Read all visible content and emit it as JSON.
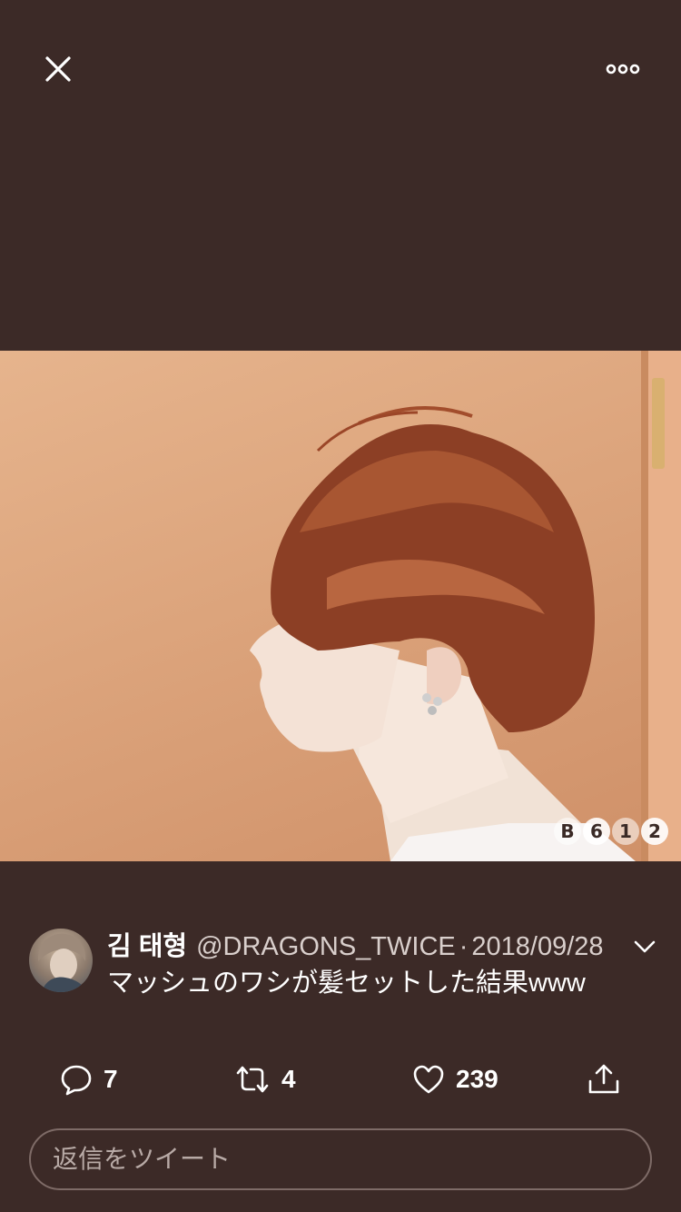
{
  "topbar": {
    "close_icon": "close-icon",
    "more_icon": "more-horizontal-icon"
  },
  "media": {
    "description_icon": "photo",
    "watermark": [
      "B",
      "6",
      "1",
      "2"
    ]
  },
  "tweet": {
    "author_name": "김 태형",
    "handle": "@DRAGONS_TWICE",
    "separator": "·",
    "date": "2018/09/28",
    "text": "マッシュのワシが髪セットした結果www",
    "avatar_icon": "avatar",
    "menu_icon": "chevron-down-icon"
  },
  "actions": {
    "reply": {
      "icon": "reply-icon",
      "count": "7"
    },
    "retweet": {
      "icon": "retweet-icon",
      "count": "4"
    },
    "like": {
      "icon": "heart-icon",
      "count": "239"
    },
    "share": {
      "icon": "share-icon"
    }
  },
  "reply_box": {
    "placeholder": "返信をツイート"
  },
  "colors": {
    "background": "#3c2a27",
    "text_primary": "#ffffff",
    "text_secondary": "#d9cfcc",
    "border": "#7e6b67"
  }
}
